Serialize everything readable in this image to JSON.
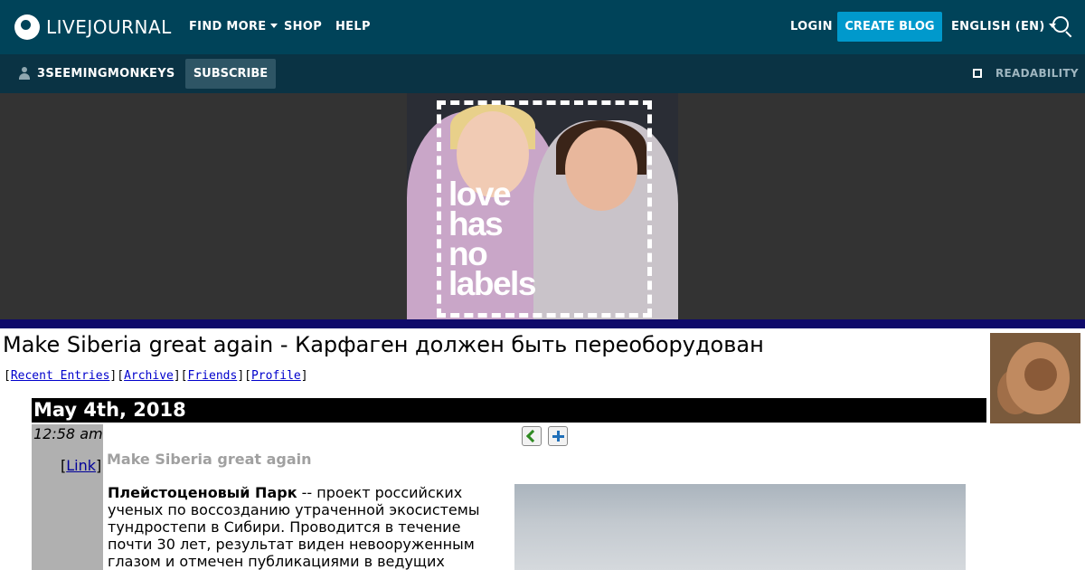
{
  "topnav": {
    "logo_text": "LIVEJOURNAL",
    "find_more": "FIND MORE",
    "shop": "SHOP",
    "help": "HELP",
    "login": "LOGIN",
    "create_blog": "CREATE BLOG",
    "language": "ENGLISH (EN)",
    "colors": {
      "background": "#004359",
      "accent": "#0099cc"
    }
  },
  "subbar": {
    "username": "3SEEMINGMONKEYS",
    "subscribe": "SUBSCRIBE",
    "readability": "READABILITY"
  },
  "banner": {
    "ad_text_lines": [
      "love",
      "has",
      "no",
      "labels"
    ]
  },
  "journal": {
    "title": "Make Siberia great again - Карфаген должен быть переоборудован",
    "nav": {
      "recent": "Recent Entries",
      "archive": "Archive",
      "friends": "Friends",
      "profile": "Profile"
    }
  },
  "entry": {
    "date": "May 4th, 2018",
    "time": "12:58 am",
    "link_label": "Link",
    "subject": "Make Siberia great again",
    "body_bold": "Плейстоценовый Парк",
    "body_text": " -- проект российских ученых по воссозданию утраченной экосистемы тундростепи в Сибири. Проводится в течение почти 30 лет, результат виден невооруженным глазом и отмечен публикациями в ведущих"
  }
}
